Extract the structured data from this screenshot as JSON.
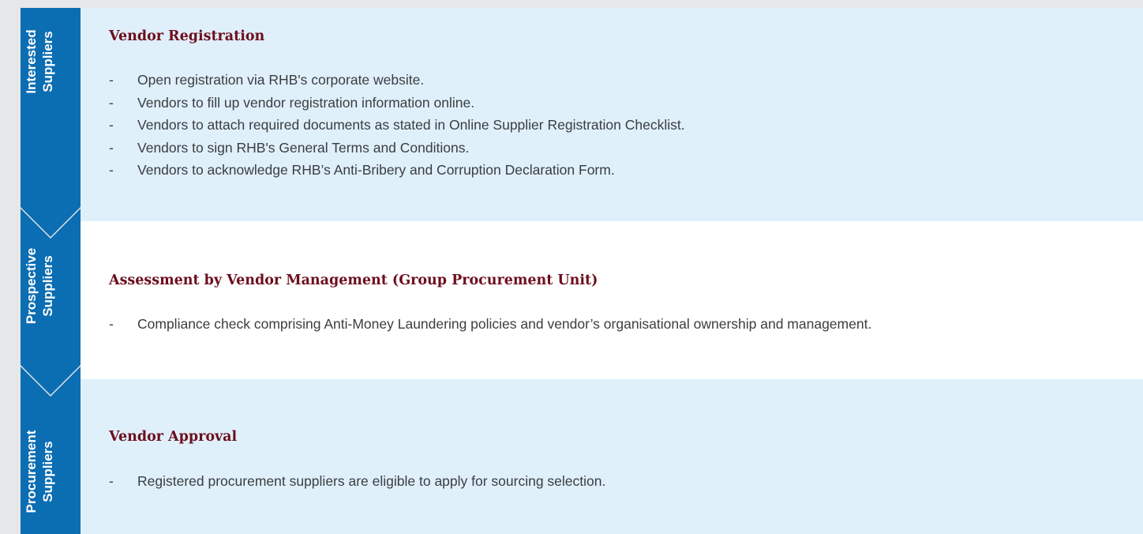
{
  "colors": {
    "page_background": "#e6e7e9",
    "chevron_blue": "#0b6db2",
    "light_blue_band": "#dff0fb",
    "white_band": "#ffffff",
    "heading_color": "#6d0f1e",
    "text_color": "#3b3d40"
  },
  "stages": [
    {
      "label_line1": "Interested",
      "label_line2": "Suppliers"
    },
    {
      "label_line1": "Prospective",
      "label_line2": "Suppliers"
    },
    {
      "label_line1": "Procurement",
      "label_line2": "Suppliers"
    }
  ],
  "sections": [
    {
      "heading": "Vendor Registration",
      "items": [
        "Open registration via RHB's corporate website.",
        "Vendors to fill up vendor registration information online.",
        "Vendors to attach required documents as stated in Online Supplier Registration Checklist.",
        "Vendors to sign RHB's General Terms and Conditions.",
        "Vendors to acknowledge RHB’s Anti-Bribery and Corruption Declaration Form."
      ]
    },
    {
      "heading": "Assessment by Vendor Management (Group Procurement Unit)",
      "items": [
        "Compliance check comprising Anti-Money Laundering policies and vendor’s organisational ownership and management."
      ]
    },
    {
      "heading": "Vendor Approval",
      "items": [
        "Registered procurement suppliers are eligible to apply for sourcing selection."
      ]
    }
  ],
  "bullet_marker": "-"
}
